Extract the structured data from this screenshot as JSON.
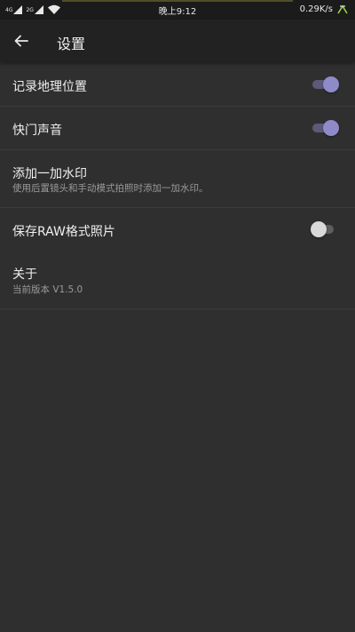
{
  "status_bar": {
    "sim1_label": "4G",
    "sim2_label": "2G",
    "time": "晚上9:12",
    "net_speed": "0.29K/s",
    "icons": [
      "signal-icon",
      "signal-icon",
      "wifi-icon",
      "shears-icon"
    ]
  },
  "app_bar": {
    "title": "设置",
    "back_icon": "arrow-left-icon"
  },
  "settings": {
    "location": {
      "title": "记录地理位置",
      "enabled": true
    },
    "shutter_sound": {
      "title": "快门声音",
      "enabled": true
    },
    "watermark": {
      "title": "添加一加水印",
      "subtitle": "使用后置镜头和手动模式拍照时添加一加水印。"
    },
    "raw": {
      "title": "保存RAW格式照片",
      "enabled": false
    },
    "about": {
      "title": "关于",
      "subtitle": "当前版本 V1.5.0"
    }
  },
  "colors": {
    "background": "#2f2f2f",
    "app_bar": "#222222",
    "accent": "#8e8bc8"
  }
}
